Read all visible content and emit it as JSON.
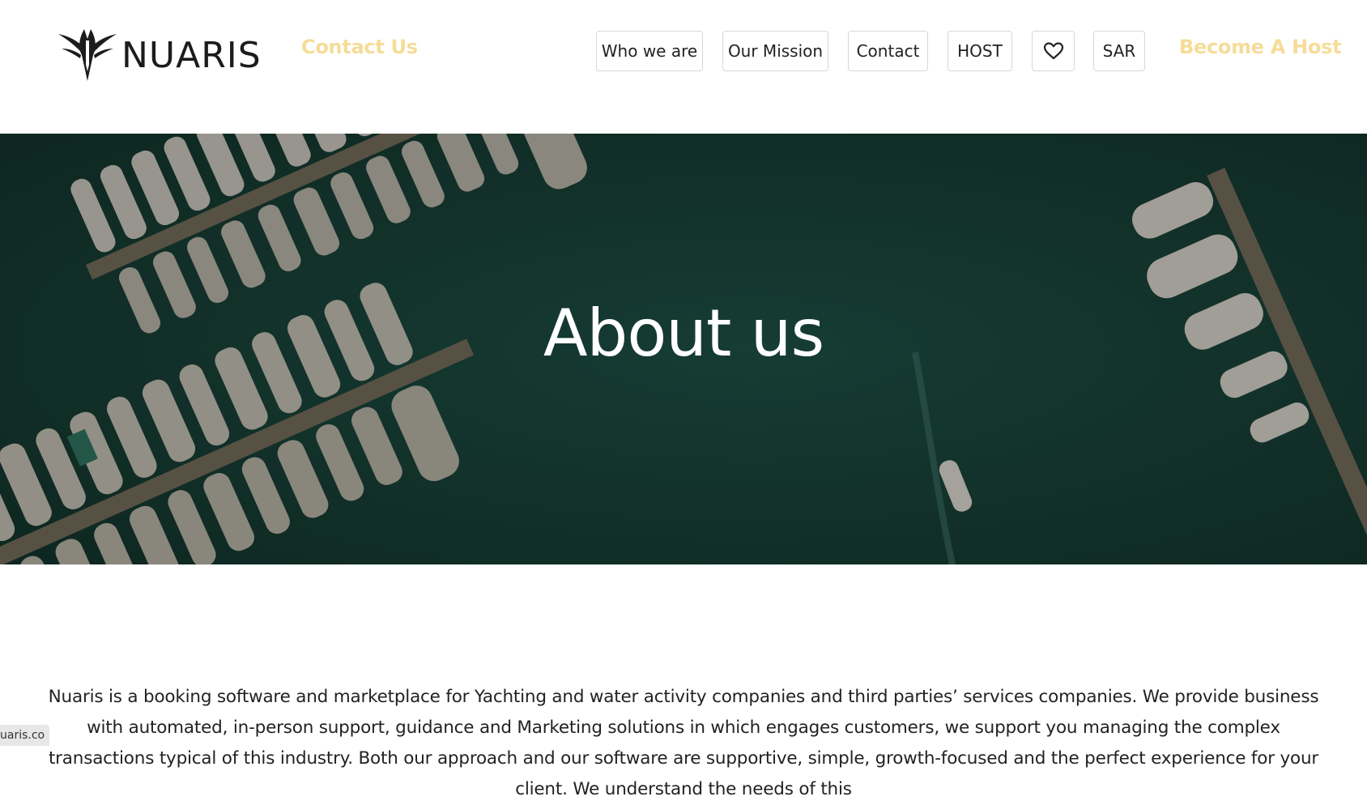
{
  "brand": {
    "name": "NUARIS",
    "logo_icon": "yacht-emblem-icon"
  },
  "header": {
    "contact_link": "Contact Us",
    "become_host": "Become A Host",
    "nav": {
      "who_we_are": "Who we are",
      "our_mission": "Our Mission",
      "contact": "Contact",
      "host": "HOST",
      "favorites_icon": "heart-icon",
      "currency": "SAR"
    }
  },
  "hero": {
    "title": "About us"
  },
  "about": {
    "paragraph": "Nuaris is a booking software and marketplace for Yachting and water activity companies and third parties’ services companies. We provide business with automated, in-person support, guidance and Marketing solutions in which engages customers, we support you managing the complex transactions typical of this industry. Both our approach and our software are supportive, simple, growth-focused and the perfect experience for your client. We understand the needs of this"
  },
  "status_bar": {
    "url": "uaris.co"
  },
  "colors": {
    "accent": "#f6dc99",
    "hero_water": "#173d36",
    "text": "#222222"
  }
}
